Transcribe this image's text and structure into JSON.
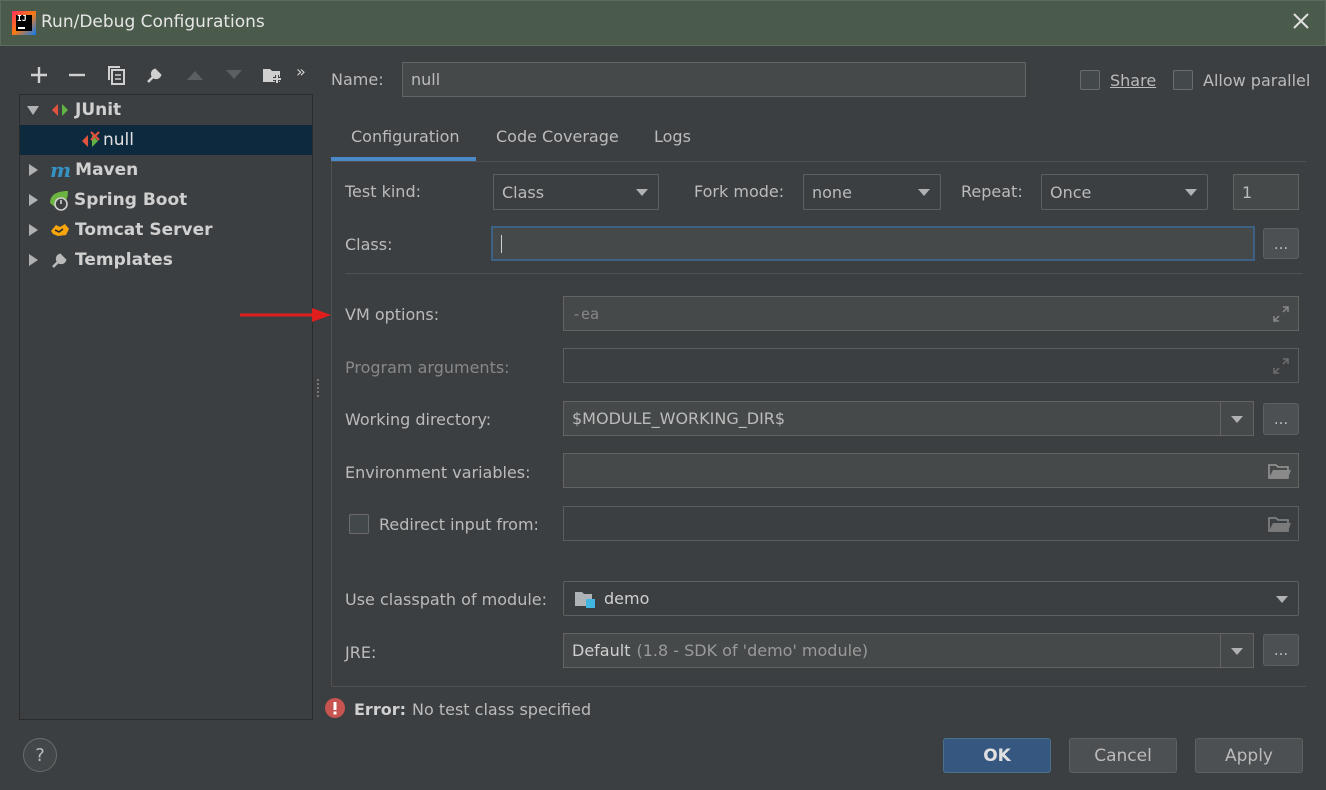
{
  "window": {
    "title": "Run/Debug Configurations",
    "app_icon_text": "IJ"
  },
  "toolbar": {
    "more_label": "»"
  },
  "tree": {
    "items": [
      {
        "label": "JUnit",
        "icon": "junit-icon",
        "expanded": true
      },
      {
        "label": "null",
        "icon": "junit-error-config-icon"
      },
      {
        "label": "Maven",
        "icon": "maven-icon",
        "expanded": false
      },
      {
        "label": "Spring Boot",
        "icon": "spring-boot-icon",
        "expanded": false
      },
      {
        "label": "Tomcat Server",
        "icon": "tomcat-icon",
        "expanded": false
      },
      {
        "label": "Templates",
        "icon": "wrench-icon",
        "expanded": false
      }
    ]
  },
  "header": {
    "name_label": "Name:",
    "name_value": "null",
    "share_label": "Share",
    "allow_parallel_label": "Allow parallel"
  },
  "tabs": [
    {
      "label": "Configuration",
      "active": true
    },
    {
      "label": "Code Coverage",
      "active": false
    },
    {
      "label": "Logs",
      "active": false
    }
  ],
  "config": {
    "test_kind_label": "Test kind:",
    "test_kind_value": "Class",
    "fork_mode_label": "Fork mode:",
    "fork_mode_value": "none",
    "repeat_label": "Repeat:",
    "repeat_value": "Once",
    "repeat_count": "1",
    "class_label": "Class:",
    "class_value": "",
    "vm_options_label": "VM options:",
    "vm_options_placeholder": "-ea",
    "program_args_label": "Program arguments:",
    "working_dir_label": "Working directory:",
    "working_dir_value": "$MODULE_WORKING_DIR$",
    "env_vars_label": "Environment variables:",
    "redirect_input_label": "Redirect input from:",
    "classpath_label": "Use classpath of module:",
    "classpath_value": "demo",
    "jre_label": "JRE:",
    "jre_value_main": "Default",
    "jre_value_detail": "(1.8 - SDK of 'demo' module)",
    "browse_label": "..."
  },
  "error": {
    "prefix": "Error:",
    "message": "No test class specified"
  },
  "footer": {
    "help_label": "?",
    "ok_label": "OK",
    "cancel_label": "Cancel",
    "apply_label": "Apply"
  },
  "colors": {
    "background": "#3c3f41",
    "titlebar": "#4a5a4b",
    "selection": "#0d293e",
    "primary_button": "#365880",
    "tab_underline": "#4a88c7",
    "error_red": "#c75450",
    "annotation_arrow": "#e01e1e"
  }
}
